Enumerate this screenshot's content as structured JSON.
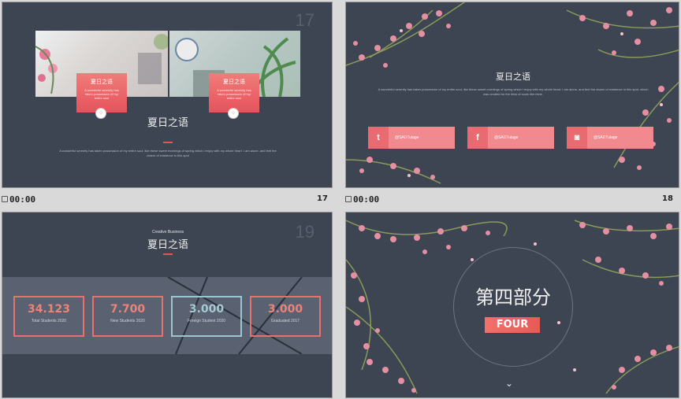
{
  "slides": [
    {
      "number": "17",
      "corner_number": "17",
      "time": "00:00",
      "title": "夏日之语",
      "cards": [
        {
          "title": "夏日之语",
          "text": "A wonderful serenity has taken possession of my entire soul"
        },
        {
          "title": "夏日之语",
          "text": "A wonderful serenity has taken possession of my entire soul"
        }
      ],
      "body": "A wonderful serenity has taken possession of my entire soul, like these sweet mornings of spring which I enjoy with my whole heart. I am alone, and feel the charm of existence in this spot"
    },
    {
      "number": "18",
      "time": "00:00",
      "title": "夏日之语",
      "body": "A wonderful serenity has taken possession of my entire soul, like these sweet mornings of spring which I enjoy with my whole heart. I am alone, and feel the charm of existence in this spot, which was created for the bliss of souls like mine.",
      "social": [
        {
          "icon": "twitter-icon",
          "glyph": "t",
          "label": "@SADTulage"
        },
        {
          "icon": "facebook-icon",
          "glyph": "f",
          "label": "@SADTulage"
        },
        {
          "icon": "instagram-icon",
          "glyph": "◙",
          "label": "@SADTulage"
        }
      ]
    },
    {
      "corner_number": "19",
      "subtitle": "Creative Business",
      "title": "夏日之语",
      "stats": [
        {
          "value": "34.123",
          "label": "Total Students 2020"
        },
        {
          "value": "7.700",
          "label": "New Students 2020"
        },
        {
          "value": "3.000",
          "label": "Foreign Student 2020"
        },
        {
          "value": "3.000",
          "label": "Graduated 2017"
        }
      ]
    },
    {
      "title": "第四部分",
      "badge": "FOUR"
    }
  ],
  "colors": {
    "accent": "#e85a55",
    "slide_bg": "#3d4452",
    "band": "#5a6170"
  }
}
